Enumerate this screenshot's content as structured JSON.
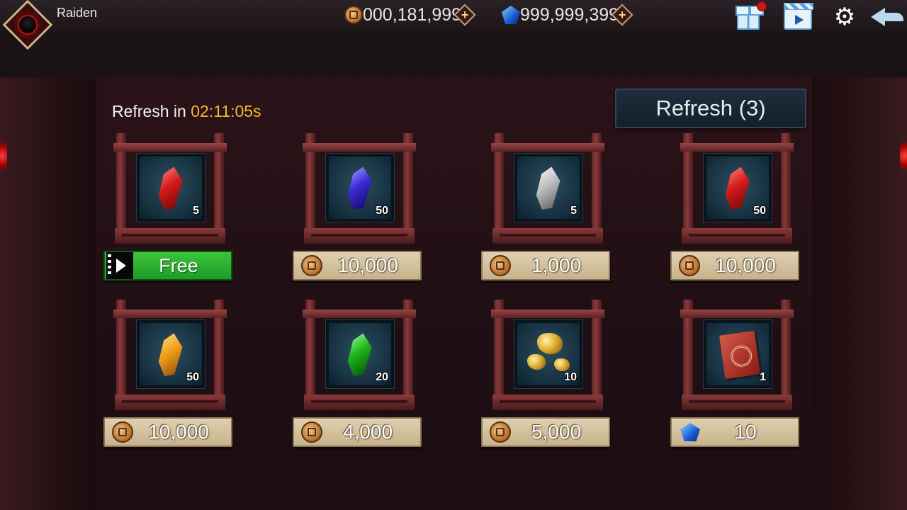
{
  "player": {
    "name": "Raiden"
  },
  "currencies": {
    "gold": "000,181,999",
    "gems": "999,999,399"
  },
  "shop": {
    "refresh_prefix": "Refresh in ",
    "refresh_time": "02:11:05s",
    "refresh_button": "Refresh (3)",
    "items": [
      {
        "qty": "5",
        "price": "Free",
        "currency": "video",
        "item_icon": "red-crystal-icon"
      },
      {
        "qty": "50",
        "price": "10,000",
        "currency": "coin",
        "item_icon": "blue-crystal-icon"
      },
      {
        "qty": "5",
        "price": "1,000",
        "currency": "coin",
        "item_icon": "white-crystal-icon"
      },
      {
        "qty": "50",
        "price": "10,000",
        "currency": "coin",
        "item_icon": "red-crystal-icon"
      },
      {
        "qty": "50",
        "price": "10,000",
        "currency": "coin",
        "item_icon": "orange-crystal-icon"
      },
      {
        "qty": "20",
        "price": "4,000",
        "currency": "coin",
        "item_icon": "green-crystal-icon"
      },
      {
        "qty": "10",
        "price": "5,000",
        "currency": "coin",
        "item_icon": "gold-ore-icon"
      },
      {
        "qty": "1",
        "price": "10",
        "currency": "gem",
        "item_icon": "scroll-icon"
      }
    ]
  },
  "colors": {
    "timer": "#f5b82e",
    "free_button": "#2db33a",
    "price_button": "#d6c4a0"
  }
}
